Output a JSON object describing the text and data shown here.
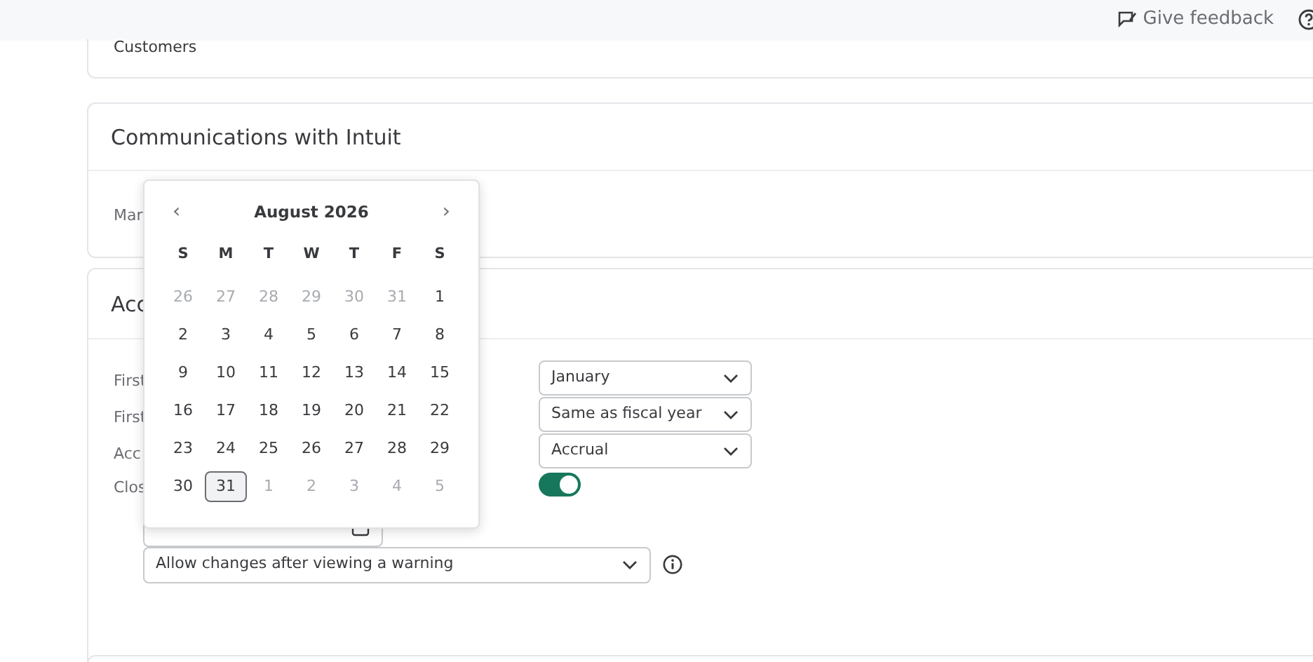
{
  "top_bar": {
    "feedback_link": "Give feedback"
  },
  "customers_card": {
    "text": "Customers"
  },
  "communications_card": {
    "title": "Communications with Intuit",
    "field_label": "Mar"
  },
  "accounting_card": {
    "title": "Acc",
    "rows": [
      {
        "label": "First",
        "value": "January",
        "kind": "select"
      },
      {
        "label": "First",
        "value": "Same as fiscal year",
        "kind": "select"
      },
      {
        "label": "Acc",
        "value": "Accrual",
        "kind": "select"
      },
      {
        "label": "Clos",
        "on": true,
        "kind": "toggle"
      }
    ],
    "close_option": {
      "value": "Allow changes after viewing a warning"
    }
  },
  "date_picker": {
    "month": "August 2026",
    "prev": "‹",
    "next": "›",
    "weekdays": [
      "S",
      "M",
      "T",
      "W",
      "T",
      "F",
      "S"
    ],
    "weeks": [
      [
        {
          "day": "26",
          "outside": true,
          "selected": false
        },
        {
          "day": "27",
          "outside": true,
          "selected": false
        },
        {
          "day": "28",
          "outside": true,
          "selected": false
        },
        {
          "day": "29",
          "outside": true,
          "selected": false
        },
        {
          "day": "30",
          "outside": true,
          "selected": false
        },
        {
          "day": "31",
          "outside": true,
          "selected": false
        },
        {
          "day": "1",
          "outside": false,
          "selected": false
        }
      ],
      [
        {
          "day": "2",
          "outside": false,
          "selected": false
        },
        {
          "day": "3",
          "outside": false,
          "selected": false
        },
        {
          "day": "4",
          "outside": false,
          "selected": false
        },
        {
          "day": "5",
          "outside": false,
          "selected": false
        },
        {
          "day": "6",
          "outside": false,
          "selected": false
        },
        {
          "day": "7",
          "outside": false,
          "selected": false
        },
        {
          "day": "8",
          "outside": false,
          "selected": false
        }
      ],
      [
        {
          "day": "9",
          "outside": false,
          "selected": false
        },
        {
          "day": "10",
          "outside": false,
          "selected": false
        },
        {
          "day": "11",
          "outside": false,
          "selected": false
        },
        {
          "day": "12",
          "outside": false,
          "selected": false
        },
        {
          "day": "13",
          "outside": false,
          "selected": false
        },
        {
          "day": "14",
          "outside": false,
          "selected": false
        },
        {
          "day": "15",
          "outside": false,
          "selected": false
        }
      ],
      [
        {
          "day": "16",
          "outside": false,
          "selected": false
        },
        {
          "day": "17",
          "outside": false,
          "selected": false
        },
        {
          "day": "18",
          "outside": false,
          "selected": false
        },
        {
          "day": "19",
          "outside": false,
          "selected": false
        },
        {
          "day": "20",
          "outside": false,
          "selected": false
        },
        {
          "day": "21",
          "outside": false,
          "selected": false
        },
        {
          "day": "22",
          "outside": false,
          "selected": false
        }
      ],
      [
        {
          "day": "23",
          "outside": false,
          "selected": false
        },
        {
          "day": "24",
          "outside": false,
          "selected": false
        },
        {
          "day": "25",
          "outside": false,
          "selected": false
        },
        {
          "day": "26",
          "outside": false,
          "selected": false
        },
        {
          "day": "27",
          "outside": false,
          "selected": false
        },
        {
          "day": "28",
          "outside": false,
          "selected": false
        },
        {
          "day": "29",
          "outside": false,
          "selected": false
        }
      ],
      [
        {
          "day": "30",
          "outside": false,
          "selected": false
        },
        {
          "day": "31",
          "outside": false,
          "selected": true
        },
        {
          "day": "1",
          "outside": true,
          "selected": false
        },
        {
          "day": "2",
          "outside": true,
          "selected": false
        },
        {
          "day": "3",
          "outside": true,
          "selected": false
        },
        {
          "day": "4",
          "outside": true,
          "selected": false
        },
        {
          "day": "5",
          "outside": true,
          "selected": false
        }
      ]
    ]
  }
}
